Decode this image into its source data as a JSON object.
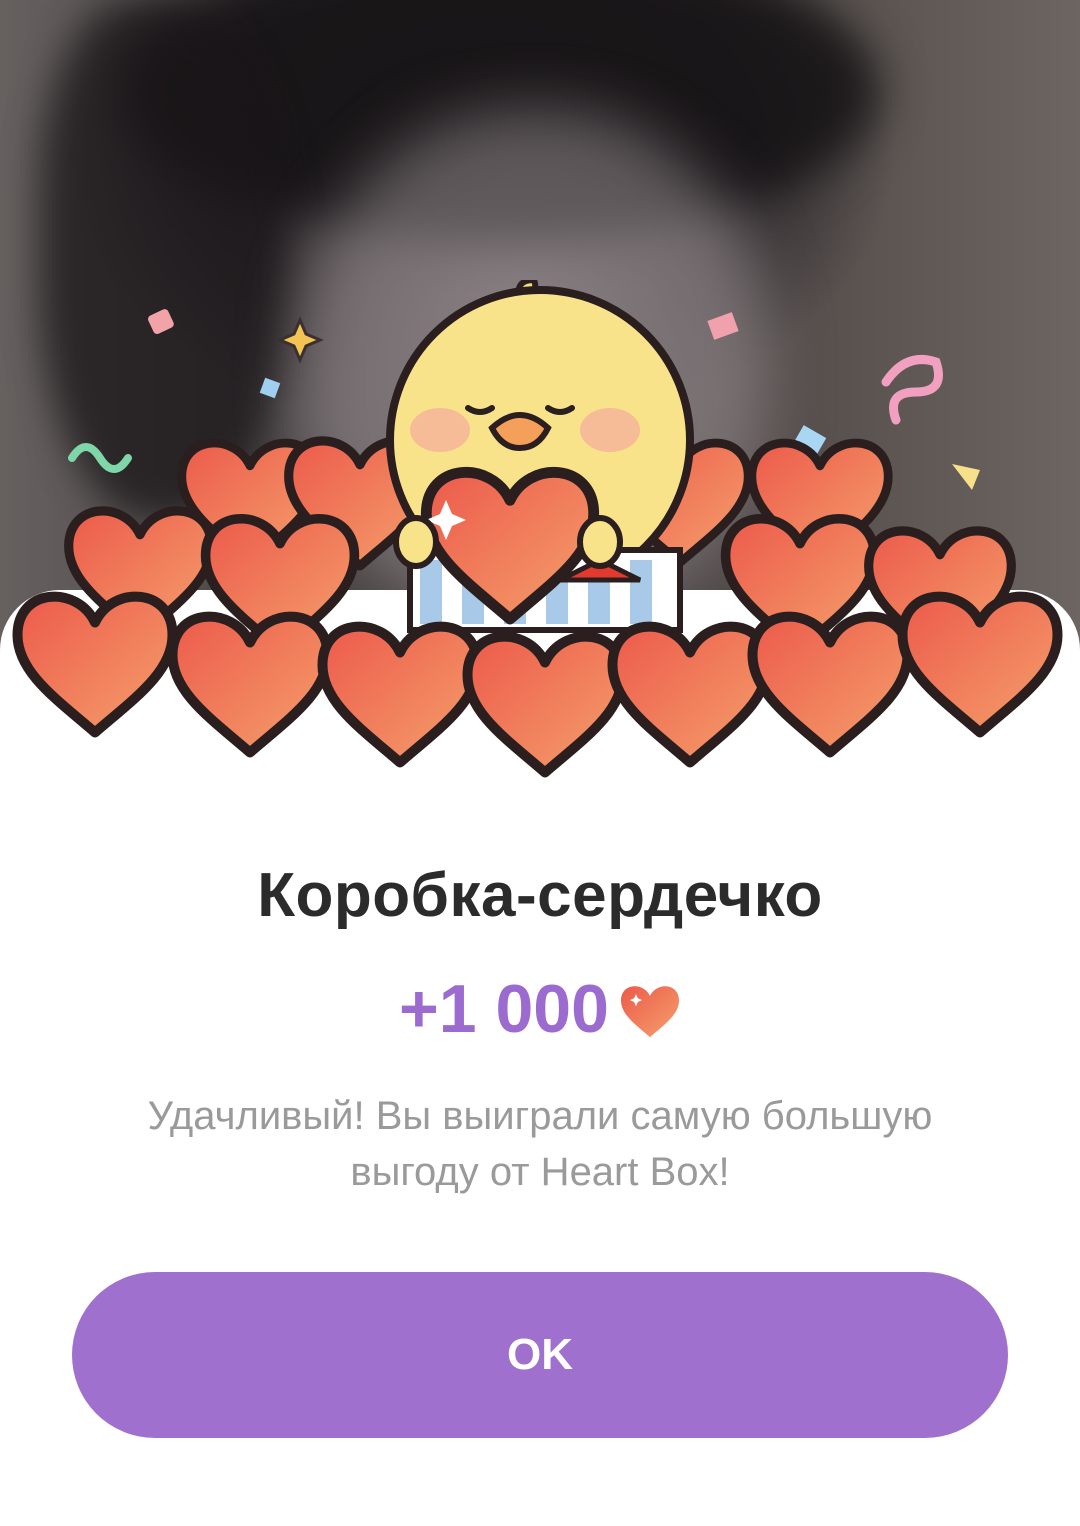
{
  "dialog": {
    "title": "Коробка-сердечко",
    "reward_amount": "+1 000",
    "reward_icon": "heart-icon",
    "message": "Удачливый! Вы выиграли самую большую выгоду от Heart Box!",
    "ok_label": "OK"
  },
  "colors": {
    "accent": "#a070cf",
    "reward_text": "#9b6bd0",
    "title_text": "#2b2b2b",
    "message_text": "#9a9a9a",
    "heart_light": "#f7a070",
    "heart_dark": "#e8554a"
  },
  "illustration": {
    "icon": "chick-with-heart-box-icon"
  }
}
